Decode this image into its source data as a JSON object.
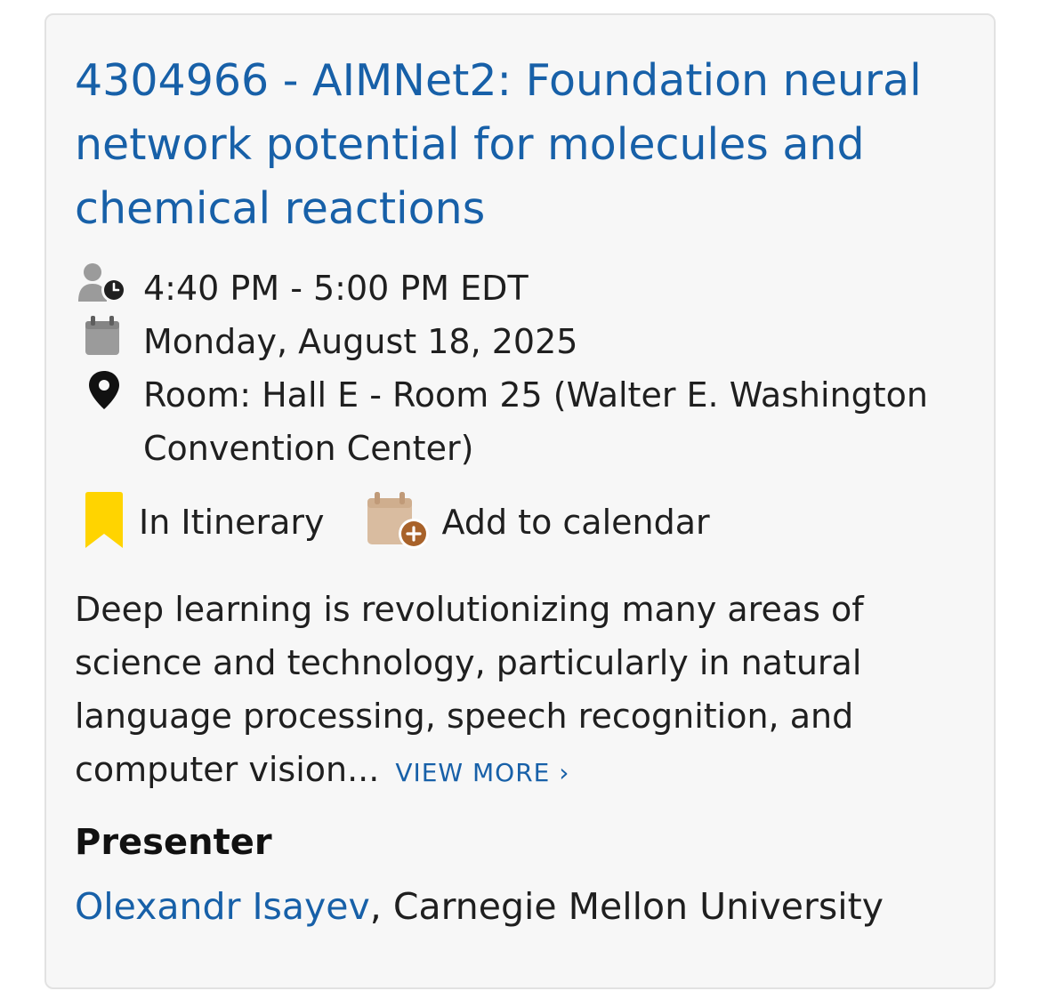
{
  "session": {
    "title": "4304966 - AIMNet2: Foundation neural network potential for molecules and chemical reactions",
    "time": "4:40 PM - 5:00 PM EDT",
    "date": "Monday, August 18, 2025",
    "room": "Room: Hall E - Room 25 (Walter E. Washington Convention Center)"
  },
  "actions": {
    "itinerary_label": "In Itinerary",
    "calendar_label": "Add to calendar"
  },
  "abstract": {
    "text": "Deep learning is revolutionizing many areas of science and technology, particularly in natural language processing, speech recognition, and computer vision...",
    "view_more_label": "VIEW MORE",
    "view_more_chevron": "›"
  },
  "presenter": {
    "heading": "Presenter",
    "name": "Olexandr Isayev",
    "separator": ", ",
    "affiliation": "Carnegie Mellon University"
  },
  "icons": {
    "time": "person-clock-icon",
    "date": "calendar-icon",
    "location": "map-pin-icon",
    "itinerary": "bookmark-icon",
    "calendar_add": "calendar-plus-icon"
  },
  "colors": {
    "link": "#1760a8",
    "bookmark": "#ffd400",
    "calendar_add_body": "#d9bca0",
    "calendar_add_plus": "#a8622a",
    "meta_icon_gray": "#9b9b9b",
    "card_background": "#f7f7f7"
  }
}
